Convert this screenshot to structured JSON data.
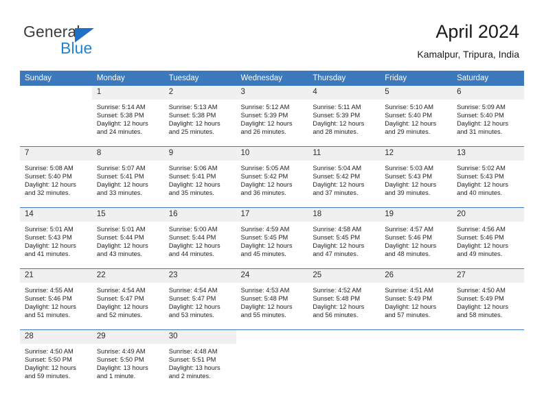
{
  "brand": {
    "name_top": "General",
    "name_bottom": "Blue",
    "accent_color": "#1f83d4",
    "triangle_color": "#1f6fc4"
  },
  "header": {
    "title": "April 2024",
    "subtitle": "Kamalpur, Tripura, India"
  },
  "calendar": {
    "header_bg": "#3b78bc",
    "daynum_bg": "#f0f0f0",
    "weekday_names": [
      "Sunday",
      "Monday",
      "Tuesday",
      "Wednesday",
      "Thursday",
      "Friday",
      "Saturday"
    ],
    "weeks": [
      [
        {
          "day": "",
          "sunrise": "",
          "sunset": "",
          "daylight_line1": "",
          "daylight_line2": ""
        },
        {
          "day": "1",
          "sunrise": "Sunrise: 5:14 AM",
          "sunset": "Sunset: 5:38 PM",
          "daylight_line1": "Daylight: 12 hours",
          "daylight_line2": "and 24 minutes."
        },
        {
          "day": "2",
          "sunrise": "Sunrise: 5:13 AM",
          "sunset": "Sunset: 5:38 PM",
          "daylight_line1": "Daylight: 12 hours",
          "daylight_line2": "and 25 minutes."
        },
        {
          "day": "3",
          "sunrise": "Sunrise: 5:12 AM",
          "sunset": "Sunset: 5:39 PM",
          "daylight_line1": "Daylight: 12 hours",
          "daylight_line2": "and 26 minutes."
        },
        {
          "day": "4",
          "sunrise": "Sunrise: 5:11 AM",
          "sunset": "Sunset: 5:39 PM",
          "daylight_line1": "Daylight: 12 hours",
          "daylight_line2": "and 28 minutes."
        },
        {
          "day": "5",
          "sunrise": "Sunrise: 5:10 AM",
          "sunset": "Sunset: 5:40 PM",
          "daylight_line1": "Daylight: 12 hours",
          "daylight_line2": "and 29 minutes."
        },
        {
          "day": "6",
          "sunrise": "Sunrise: 5:09 AM",
          "sunset": "Sunset: 5:40 PM",
          "daylight_line1": "Daylight: 12 hours",
          "daylight_line2": "and 31 minutes."
        }
      ],
      [
        {
          "day": "7",
          "sunrise": "Sunrise: 5:08 AM",
          "sunset": "Sunset: 5:40 PM",
          "daylight_line1": "Daylight: 12 hours",
          "daylight_line2": "and 32 minutes."
        },
        {
          "day": "8",
          "sunrise": "Sunrise: 5:07 AM",
          "sunset": "Sunset: 5:41 PM",
          "daylight_line1": "Daylight: 12 hours",
          "daylight_line2": "and 33 minutes."
        },
        {
          "day": "9",
          "sunrise": "Sunrise: 5:06 AM",
          "sunset": "Sunset: 5:41 PM",
          "daylight_line1": "Daylight: 12 hours",
          "daylight_line2": "and 35 minutes."
        },
        {
          "day": "10",
          "sunrise": "Sunrise: 5:05 AM",
          "sunset": "Sunset: 5:42 PM",
          "daylight_line1": "Daylight: 12 hours",
          "daylight_line2": "and 36 minutes."
        },
        {
          "day": "11",
          "sunrise": "Sunrise: 5:04 AM",
          "sunset": "Sunset: 5:42 PM",
          "daylight_line1": "Daylight: 12 hours",
          "daylight_line2": "and 37 minutes."
        },
        {
          "day": "12",
          "sunrise": "Sunrise: 5:03 AM",
          "sunset": "Sunset: 5:43 PM",
          "daylight_line1": "Daylight: 12 hours",
          "daylight_line2": "and 39 minutes."
        },
        {
          "day": "13",
          "sunrise": "Sunrise: 5:02 AM",
          "sunset": "Sunset: 5:43 PM",
          "daylight_line1": "Daylight: 12 hours",
          "daylight_line2": "and 40 minutes."
        }
      ],
      [
        {
          "day": "14",
          "sunrise": "Sunrise: 5:01 AM",
          "sunset": "Sunset: 5:43 PM",
          "daylight_line1": "Daylight: 12 hours",
          "daylight_line2": "and 41 minutes."
        },
        {
          "day": "15",
          "sunrise": "Sunrise: 5:01 AM",
          "sunset": "Sunset: 5:44 PM",
          "daylight_line1": "Daylight: 12 hours",
          "daylight_line2": "and 43 minutes."
        },
        {
          "day": "16",
          "sunrise": "Sunrise: 5:00 AM",
          "sunset": "Sunset: 5:44 PM",
          "daylight_line1": "Daylight: 12 hours",
          "daylight_line2": "and 44 minutes."
        },
        {
          "day": "17",
          "sunrise": "Sunrise: 4:59 AM",
          "sunset": "Sunset: 5:45 PM",
          "daylight_line1": "Daylight: 12 hours",
          "daylight_line2": "and 45 minutes."
        },
        {
          "day": "18",
          "sunrise": "Sunrise: 4:58 AM",
          "sunset": "Sunset: 5:45 PM",
          "daylight_line1": "Daylight: 12 hours",
          "daylight_line2": "and 47 minutes."
        },
        {
          "day": "19",
          "sunrise": "Sunrise: 4:57 AM",
          "sunset": "Sunset: 5:46 PM",
          "daylight_line1": "Daylight: 12 hours",
          "daylight_line2": "and 48 minutes."
        },
        {
          "day": "20",
          "sunrise": "Sunrise: 4:56 AM",
          "sunset": "Sunset: 5:46 PM",
          "daylight_line1": "Daylight: 12 hours",
          "daylight_line2": "and 49 minutes."
        }
      ],
      [
        {
          "day": "21",
          "sunrise": "Sunrise: 4:55 AM",
          "sunset": "Sunset: 5:46 PM",
          "daylight_line1": "Daylight: 12 hours",
          "daylight_line2": "and 51 minutes."
        },
        {
          "day": "22",
          "sunrise": "Sunrise: 4:54 AM",
          "sunset": "Sunset: 5:47 PM",
          "daylight_line1": "Daylight: 12 hours",
          "daylight_line2": "and 52 minutes."
        },
        {
          "day": "23",
          "sunrise": "Sunrise: 4:54 AM",
          "sunset": "Sunset: 5:47 PM",
          "daylight_line1": "Daylight: 12 hours",
          "daylight_line2": "and 53 minutes."
        },
        {
          "day": "24",
          "sunrise": "Sunrise: 4:53 AM",
          "sunset": "Sunset: 5:48 PM",
          "daylight_line1": "Daylight: 12 hours",
          "daylight_line2": "and 55 minutes."
        },
        {
          "day": "25",
          "sunrise": "Sunrise: 4:52 AM",
          "sunset": "Sunset: 5:48 PM",
          "daylight_line1": "Daylight: 12 hours",
          "daylight_line2": "and 56 minutes."
        },
        {
          "day": "26",
          "sunrise": "Sunrise: 4:51 AM",
          "sunset": "Sunset: 5:49 PM",
          "daylight_line1": "Daylight: 12 hours",
          "daylight_line2": "and 57 minutes."
        },
        {
          "day": "27",
          "sunrise": "Sunrise: 4:50 AM",
          "sunset": "Sunset: 5:49 PM",
          "daylight_line1": "Daylight: 12 hours",
          "daylight_line2": "and 58 minutes."
        }
      ],
      [
        {
          "day": "28",
          "sunrise": "Sunrise: 4:50 AM",
          "sunset": "Sunset: 5:50 PM",
          "daylight_line1": "Daylight: 12 hours",
          "daylight_line2": "and 59 minutes."
        },
        {
          "day": "29",
          "sunrise": "Sunrise: 4:49 AM",
          "sunset": "Sunset: 5:50 PM",
          "daylight_line1": "Daylight: 13 hours",
          "daylight_line2": "and 1 minute."
        },
        {
          "day": "30",
          "sunrise": "Sunrise: 4:48 AM",
          "sunset": "Sunset: 5:51 PM",
          "daylight_line1": "Daylight: 13 hours",
          "daylight_line2": "and 2 minutes."
        },
        {
          "day": "",
          "sunrise": "",
          "sunset": "",
          "daylight_line1": "",
          "daylight_line2": ""
        },
        {
          "day": "",
          "sunrise": "",
          "sunset": "",
          "daylight_line1": "",
          "daylight_line2": ""
        },
        {
          "day": "",
          "sunrise": "",
          "sunset": "",
          "daylight_line1": "",
          "daylight_line2": ""
        },
        {
          "day": "",
          "sunrise": "",
          "sunset": "",
          "daylight_line1": "",
          "daylight_line2": ""
        }
      ]
    ]
  }
}
